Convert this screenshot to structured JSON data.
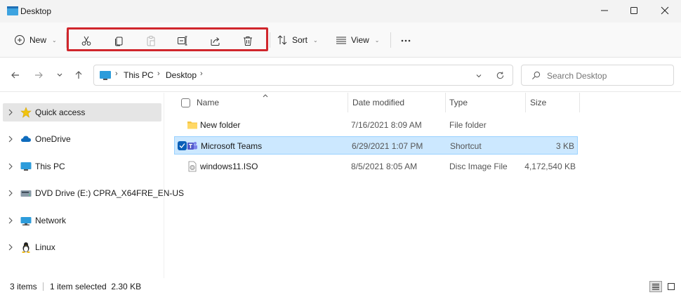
{
  "window": {
    "title": "Desktop"
  },
  "toolbar": {
    "new_label": "New",
    "sort_label": "Sort",
    "view_label": "View",
    "actions": [
      "cut",
      "copy",
      "paste",
      "rename",
      "share",
      "delete"
    ],
    "highlight_color": "#d0262c"
  },
  "address": {
    "crumbs": [
      "This PC",
      "Desktop"
    ],
    "search_placeholder": "Search Desktop"
  },
  "sidebar": {
    "items": [
      {
        "label": "Quick access",
        "icon": "star-icon"
      },
      {
        "label": "OneDrive",
        "icon": "cloud-icon"
      },
      {
        "label": "This PC",
        "icon": "computer-icon"
      },
      {
        "label": "DVD Drive (E:) CPRA_X64FRE_EN-US",
        "icon": "dvd-icon"
      },
      {
        "label": "Network",
        "icon": "network-icon"
      },
      {
        "label": "Linux",
        "icon": "linux-icon"
      }
    ]
  },
  "columns": {
    "name": "Name",
    "date": "Date modified",
    "type": "Type",
    "size": "Size"
  },
  "files": [
    {
      "name": "New folder",
      "date": "7/16/2021 8:09 AM",
      "type": "File folder",
      "size": "",
      "icon": "folder-icon"
    },
    {
      "name": "Microsoft Teams",
      "date": "6/29/2021 1:07 PM",
      "type": "Shortcut",
      "size": "3 KB",
      "icon": "teams-icon",
      "selected": true
    },
    {
      "name": "windows11.ISO",
      "date": "8/5/2021 8:05 AM",
      "type": "Disc Image File",
      "size": "4,172,540 KB",
      "icon": "disc-image-icon"
    }
  ],
  "status": {
    "items": "3 items",
    "selection": "1 item selected  2.30 KB"
  },
  "colors": {
    "selection": "#cce8ff",
    "accent": "#0a5fb8",
    "folder": "#f4c542"
  }
}
